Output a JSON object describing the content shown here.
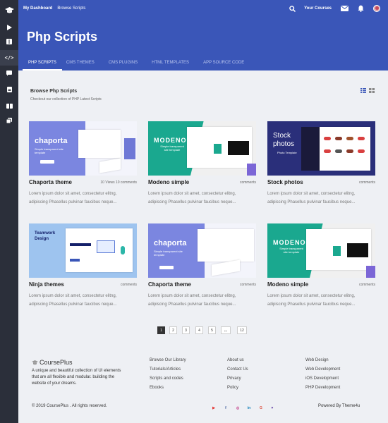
{
  "topbar": {
    "breadcrumb": [
      "My Dashboard",
      "Browse Scripts"
    ],
    "your_courses": "Your Courses"
  },
  "hero": {
    "title": "Php Scripts"
  },
  "tabs": [
    {
      "label": "PHP SCRIPTS",
      "active": true
    },
    {
      "label": "CMS THEMES"
    },
    {
      "label": "CMS PLUGINS"
    },
    {
      "label": "HTML TEMPLATES"
    },
    {
      "label": "APP SOURCE CODE"
    }
  ],
  "section": {
    "title": "Browse Php Scripts",
    "subtitle": "Checkout our collection of PHP Latest Scripts"
  },
  "cards": [
    {
      "title": "Chaporta theme",
      "meta": "10 Views 10 comments",
      "desc1": "Lorem ipsum dolor sit amet, consectetur  elitng,",
      "desc2": "adipiscing Phasellus pulvinar faucibus neque...",
      "thumb_text": "chaporta",
      "thumb_sub": "Simple transparent site template",
      "bg": "#7b86e0"
    },
    {
      "title": "Modeno simple",
      "meta": "comments",
      "desc1": "Lorem ipsum dolor sit amet, consectetur  elitng,",
      "desc2": "adipiscing Phasellus pulvinar faucibus neque...",
      "thumb_text": "MODENO",
      "thumb_sub": "Simple transparent site template",
      "bg": "#1aa88f"
    },
    {
      "title": "Stock photos",
      "meta": "comments",
      "desc1": "Lorem ipsum dolor sit amet, consectetur  elitng,",
      "desc2": "adipiscing Phasellus pulvinar faucibus neque...",
      "thumb_text": "Stock photos",
      "thumb_sub": "Photo Template",
      "bg": "#2a2f7a"
    },
    {
      "title": "Ninja themes",
      "meta": "comments",
      "desc1": "Lorem ipsum dolor sit amet, consectetur  elitng,",
      "desc2": "adipiscing Phasellus pulvinar faucibus neque...",
      "thumb_text": "Teamwork Design",
      "thumb_sub": "",
      "bg": "#9ec4ef"
    },
    {
      "title": "Chaporta theme",
      "meta": "comments",
      "desc1": "Lorem ipsum dolor sit amet, consectetur  elitng,",
      "desc2": "adipiscing Phasellus pulvinar faucibus neque...",
      "thumb_text": "chaporta",
      "thumb_sub": "Simple transparent site template",
      "bg": "#7b86e0"
    },
    {
      "title": "Modeno simple",
      "meta": "comments",
      "desc1": "Lorem ipsum dolor sit amet, consectetur  elitng,",
      "desc2": "adipiscing Phasellus pulvinar faucibus neque...",
      "thumb_text": "MODENO",
      "thumb_sub": "Simple transparent site template",
      "bg": "#1aa88f"
    }
  ],
  "pagination": [
    "1",
    "2",
    "3",
    "4",
    "5",
    "...",
    "12"
  ],
  "footer": {
    "brand": "CoursePlus",
    "about": [
      "A unique and beautiful collection of UI elements",
      "that are all flexible and modular. building the",
      "website of your dreams."
    ],
    "col1": [
      "Browse Our Library",
      "Tutorials/Articles",
      "Scripts and codes",
      "Ebooks"
    ],
    "col2": [
      "About us",
      "Contact Us",
      "Privacy",
      "Policy"
    ],
    "col3": [
      "Web Design",
      "Web Development",
      "iOS Development",
      "PHP Development"
    ],
    "copyright": "© 2019 CoursePlus . All rights reserved.",
    "powered": "Powered By Theme4u"
  },
  "colors": {
    "primary": "#3a56b8",
    "sidebar": "#2b2f3a",
    "bg": "#eef0f4"
  },
  "icons": [
    "graduation-cap-icon",
    "play-icon",
    "book-icon",
    "code-icon",
    "comment-icon",
    "document-icon",
    "book-open-icon",
    "copy-icon",
    "search-icon",
    "mail-icon",
    "bell-icon"
  ]
}
